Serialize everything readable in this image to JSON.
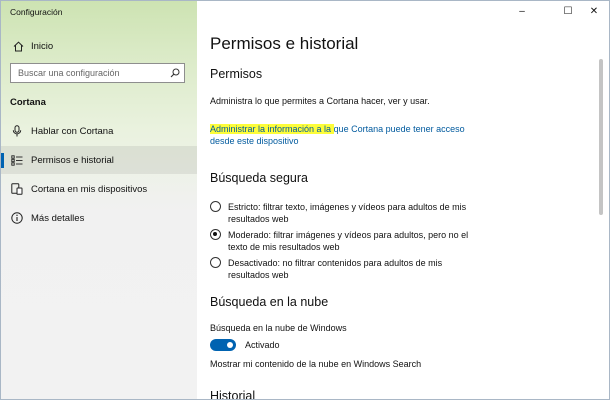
{
  "window": {
    "title": "Configuración",
    "controls": {
      "minimize": "–",
      "maximize": "☐",
      "close": "✕"
    }
  },
  "sidebar": {
    "home_label": "Inicio",
    "search": {
      "placeholder": "Buscar una configuración",
      "value": ""
    },
    "section_label": "Cortana",
    "items": [
      {
        "label": "Hablar con Cortana",
        "icon": "microphone-icon",
        "selected": false
      },
      {
        "label": "Permisos e historial",
        "icon": "permissions-list-icon",
        "selected": true
      },
      {
        "label": "Cortana en mis dispositivos",
        "icon": "devices-icon",
        "selected": false
      },
      {
        "label": "Más detalles",
        "icon": "info-icon",
        "selected": false
      }
    ]
  },
  "main": {
    "title": "Permisos e historial",
    "permisos": {
      "heading": "Permisos",
      "description": "Administra lo que permites a Cortana hacer, ver y usar.",
      "link_highlighted": "Administrar la información a la ",
      "link_rest_line1": "que Cortana puede tener acceso",
      "link_line2": "desde este dispositivo"
    },
    "safe_search": {
      "heading": "Búsqueda segura",
      "options": [
        {
          "label": "Estricto: filtrar texto, imágenes y vídeos para adultos de mis resultados web",
          "checked": false
        },
        {
          "label": "Moderado: filtrar imágenes y vídeos para adultos, pero no el texto de mis resultados web",
          "checked": true
        },
        {
          "label": "Desactivado: no filtrar contenidos para adultos de mis resultados web",
          "checked": false
        }
      ]
    },
    "cloud_search": {
      "heading": "Búsqueda en la nube",
      "toggle_caption": "Búsqueda en la nube de Windows",
      "toggle_state": "Activado",
      "toggle_on": true,
      "footer_text": "Mostrar mi contenido de la nube en Windows Search"
    },
    "history": {
      "heading": "Historial"
    }
  },
  "colors": {
    "accent": "#0063b1",
    "link": "#005a9e",
    "highlight": "#fdfd3a",
    "sidebar_top": "#cde3b2",
    "sidebar_bottom": "#f2f2f2"
  }
}
